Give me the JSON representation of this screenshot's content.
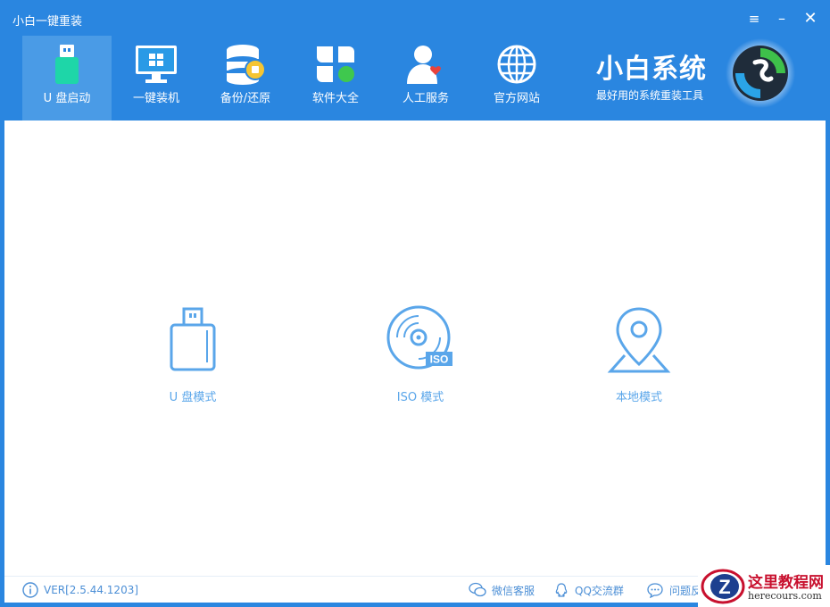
{
  "window": {
    "title": "小白一键重装",
    "controls": {
      "menu": "≡",
      "minimize": "–",
      "close": "✕"
    }
  },
  "nav": {
    "items": [
      {
        "label": "U 盘启动",
        "icon": "usb-drive-icon",
        "active": true
      },
      {
        "label": "一键装机",
        "icon": "monitor-windows-icon"
      },
      {
        "label": "备份/还原",
        "icon": "database-backup-icon"
      },
      {
        "label": "软件大全",
        "icon": "apps-clover-icon"
      },
      {
        "label": "人工服务",
        "icon": "person-heart-icon"
      },
      {
        "label": "官方网站",
        "icon": "globe-icon"
      }
    ]
  },
  "brand": {
    "name": "小白系统",
    "tagline": "最好用的系统重装工具"
  },
  "modes": [
    {
      "label": "U 盘模式",
      "icon": "usb-stick-icon"
    },
    {
      "label": "ISO 模式",
      "icon": "iso-disc-icon",
      "badge": "ISO"
    },
    {
      "label": "本地模式",
      "icon": "map-pin-icon"
    }
  ],
  "status": {
    "version": "VER[2.5.44.1203]",
    "links": [
      {
        "label": "微信客服",
        "icon": "wechat-icon"
      },
      {
        "label": "QQ交流群",
        "icon": "qq-icon"
      },
      {
        "label": "问题反",
        "icon": "chat-bubble-icon"
      }
    ]
  },
  "watermark": {
    "letter": "Z",
    "line1": "这里教程网",
    "line2": "herecours.com"
  },
  "colors": {
    "header": "#2a86e0",
    "active_tab": "#4a9be6",
    "accent": "#5aa6ea",
    "background": "#ffffff"
  }
}
